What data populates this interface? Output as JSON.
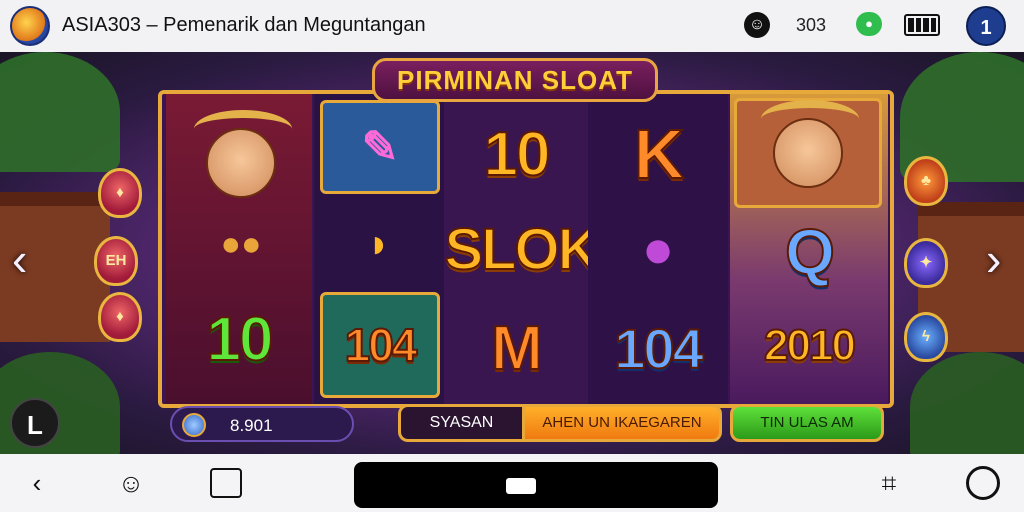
{
  "app": {
    "title": "ASIA303 – Pemenarik dan Meguntangan",
    "status_count": "303",
    "avatar_letter": "1"
  },
  "game": {
    "banner": "PIRMINAN SLOAT",
    "reel_symbols": {
      "reel2_bottom": "10",
      "reel3_top": "10",
      "reel3_mid": "SLOK",
      "reel3_bottom": "M",
      "reel4_top": "K",
      "reel4_bottom": "104",
      "reel5_mid": "Q",
      "reel5_bottom": "2010",
      "reel1_bottom": "10",
      "reel2_bottom_frame": "104"
    },
    "side_gem_label": "EH",
    "balance": "8.901",
    "button_system": "SYASAN",
    "button_arrange": "AHEN UN IKAEGAREN",
    "button_play": "TIN ULAS AM",
    "floating_letter": "L"
  },
  "icons": {
    "left_arrow": "chevron-left-icon",
    "right_arrow": "chevron-right-icon",
    "back": "back-icon",
    "assistant": "assistant-icon",
    "recents": "recents-icon",
    "screenshot": "screenshot-icon",
    "circle": "circle-icon"
  }
}
